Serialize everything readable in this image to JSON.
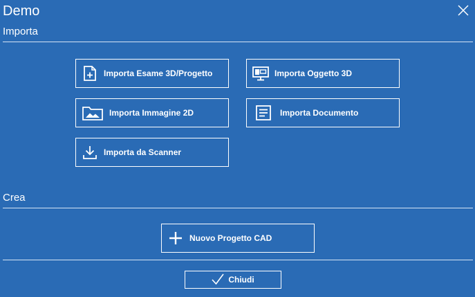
{
  "window": {
    "title": "Demo"
  },
  "sections": {
    "import": "Importa",
    "create": "Crea"
  },
  "import_buttons": [
    {
      "label": "Importa Esame 3D/Progetto",
      "icon": "file-plus-icon"
    },
    {
      "label": "Importa Oggetto 3D",
      "icon": "monitor-icon"
    },
    {
      "label": "Importa Immagine 2D",
      "icon": "image-folder-icon"
    },
    {
      "label": "Importa Documento",
      "icon": "document-icon"
    },
    {
      "label": "Importa da Scanner",
      "icon": "download-icon"
    }
  ],
  "create_button": {
    "label": "Nuovo Progetto CAD",
    "icon": "plus-icon"
  },
  "footer": {
    "close_label": "Chiudi",
    "close_icon": "check-icon"
  }
}
